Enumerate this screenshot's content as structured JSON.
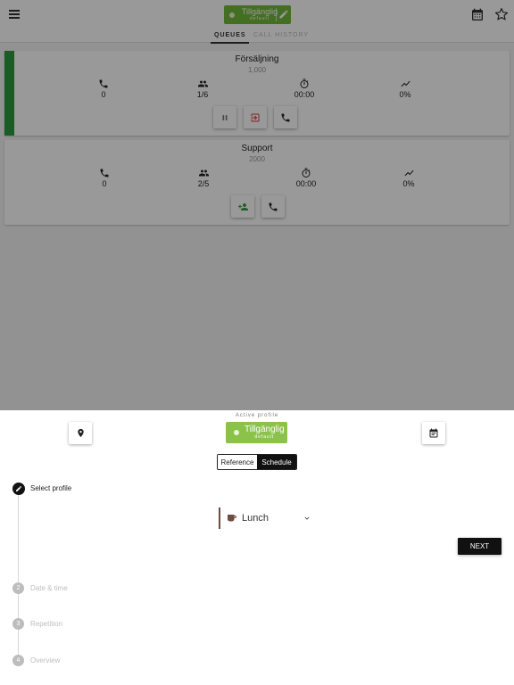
{
  "header": {
    "status": {
      "label": "Tillgänglig",
      "sublabel": "default",
      "color": "#72b83a"
    },
    "icons": [
      "menu-icon",
      "pencil-icon",
      "calendar-icon",
      "star-icon"
    ]
  },
  "tabs": [
    {
      "label": "QUEUES",
      "active": true
    },
    {
      "label": "CALL HISTORY",
      "active": false
    }
  ],
  "queues": [
    {
      "name": "Försäljning",
      "number": "1,000",
      "accent_color": "#2e9a3e",
      "stats": {
        "calls": "0",
        "agents": "1/6",
        "wait_time": "00:00",
        "rate": "0%"
      },
      "actions": [
        "pause-icon",
        "logout-icon",
        "phone-icon"
      ]
    },
    {
      "name": "Support",
      "number": "2000",
      "stats": {
        "calls": "0",
        "agents": "2/5",
        "wait_time": "00:00",
        "rate": "0%"
      },
      "actions": [
        "add-person-icon",
        "phone-icon"
      ]
    }
  ],
  "sheet": {
    "active_profile_label": "Active profile",
    "status": {
      "label": "Tillgänglig",
      "sublabel": "default",
      "color": "#8bc34a"
    },
    "toggle": {
      "reference": "Reference",
      "schedule": "Schedule",
      "selected": "Schedule"
    },
    "steps": [
      {
        "number": "",
        "label": "Select profile",
        "active": true
      },
      {
        "number": "2",
        "label": "Date & time",
        "active": false
      },
      {
        "number": "3",
        "label": "Repetition",
        "active": false
      },
      {
        "number": "4",
        "label": "Overview",
        "active": false
      }
    ],
    "profile_select": {
      "value": "Lunch",
      "accent_color": "#6d4c41"
    },
    "next_button": "NEXT"
  }
}
